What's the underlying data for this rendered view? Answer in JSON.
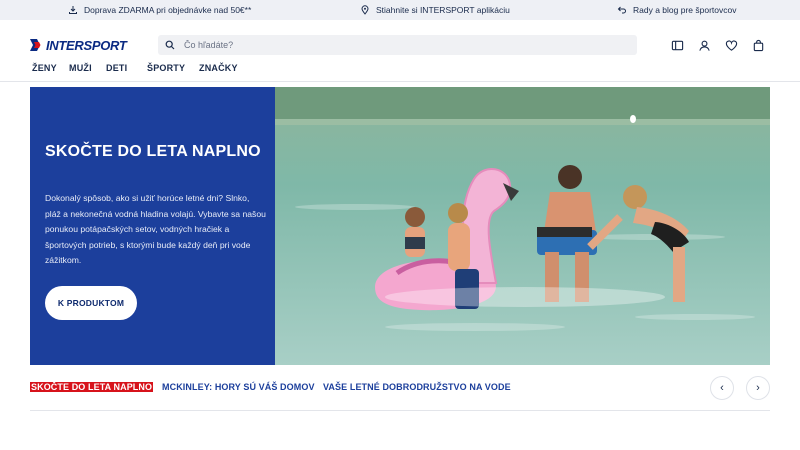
{
  "topbar": {
    "shipping": "Doprava ZDARMA pri objednávke nad 50€**",
    "app": "Stiahnite si INTERSPORT aplikáciu",
    "blog": "Rady a blog pre športovcov"
  },
  "header": {
    "logo_text": "INTERSPORT",
    "search_placeholder": "Čo hľadáte?",
    "icons": [
      "catalog-icon",
      "user-icon",
      "heart-icon",
      "bag-icon"
    ]
  },
  "nav": {
    "items": [
      "ŽENY",
      "MUŽI",
      "DETI",
      "ŠPORTY",
      "ZNAČKY"
    ]
  },
  "hero": {
    "title": "SKOČTE DO LETA NAPLNO",
    "text": "Dokonalý spôsob, ako si užiť horúce letné dni? Slnko, pláž a nekonečná vodná hladina volajú. Vybavte sa našou ponukou potápačských setov, vodných hračiek a športových potrieb, s ktorými bude každý deň pri vode zážitkom.",
    "button": "K PRODUKTOM"
  },
  "tabs": {
    "items": [
      "SKOČTE DO LETA NAPLNO",
      "MCKINLEY: HORY SÚ VÁŠ DOMOV",
      "VAŠE LETNÉ DOBRODRUŽSTVO NA VODE"
    ],
    "prev": "‹",
    "next": "›"
  },
  "colors": {
    "brand_blue": "#1c3f9c",
    "accent_red": "#d7131b",
    "topbar_bg": "#eef0f5"
  }
}
